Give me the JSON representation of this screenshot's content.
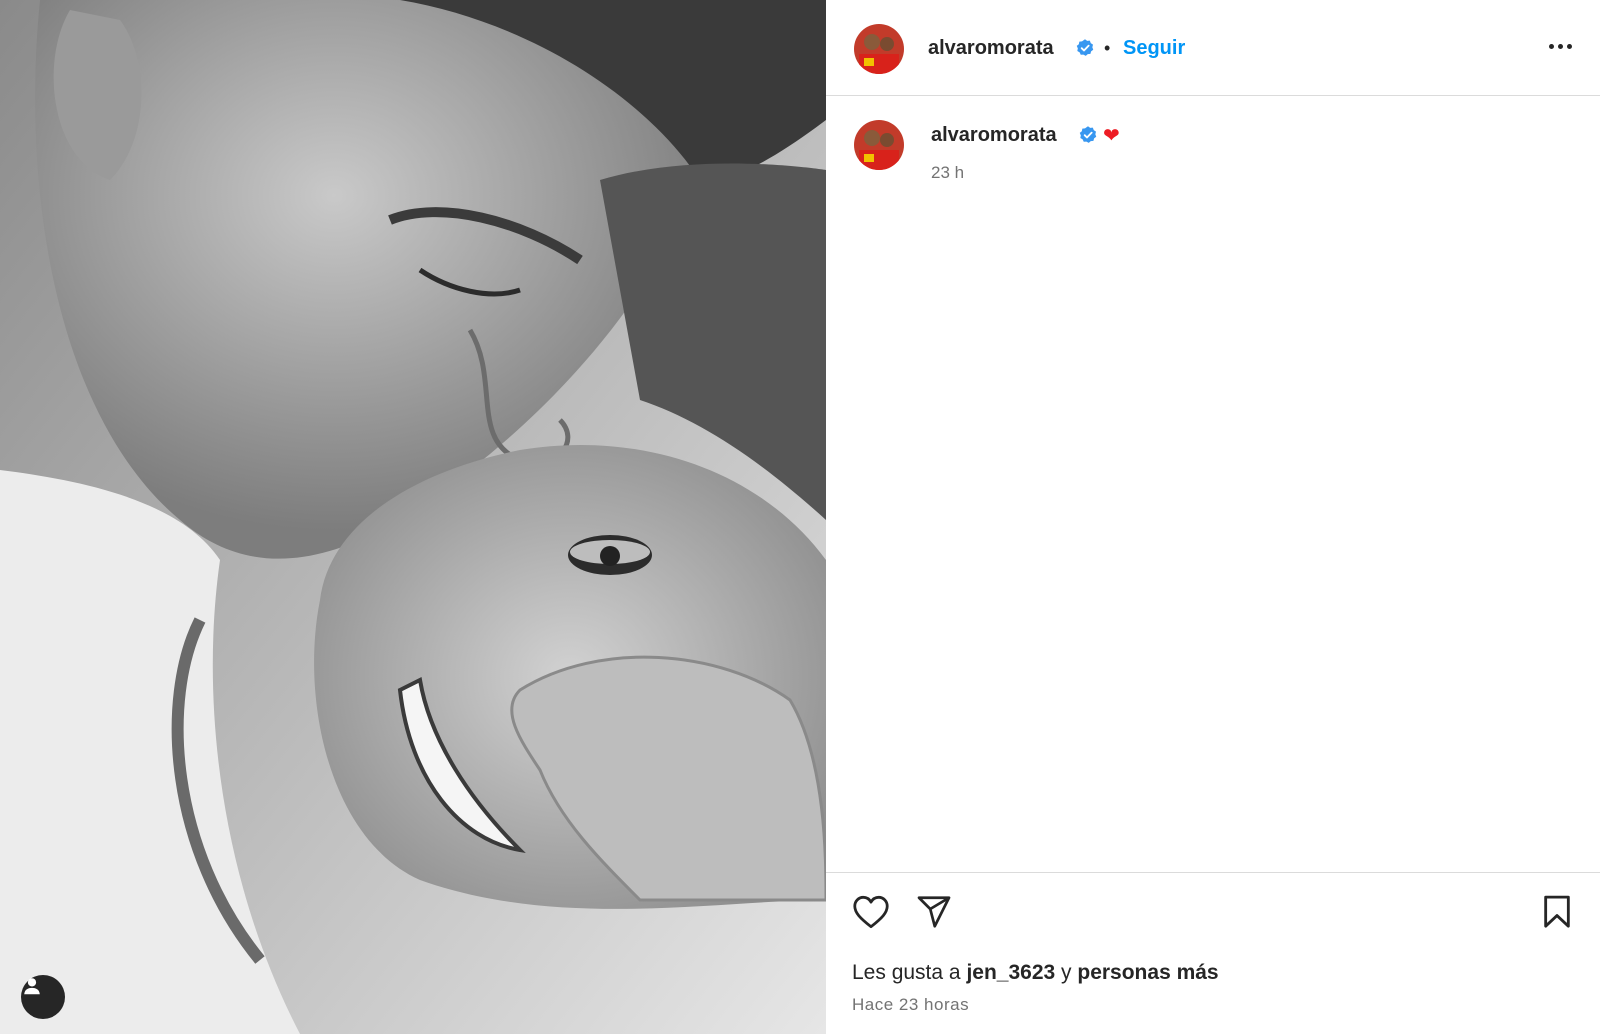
{
  "post": {
    "username": "alvaromorata",
    "follow_label": "Seguir",
    "separator": "•",
    "caption_emoji": "❤",
    "caption_time": "23 h",
    "likes_prefix": "Les gusta a",
    "likes_user": "jen_3623",
    "likes_joiner": "y",
    "likes_suffix": "personas más",
    "posted_ago": "Hace 23 horas"
  },
  "colors": {
    "link_blue": "#0095f6",
    "verified_blue": "#3897f0",
    "heart_red": "#ed1c24",
    "border": "#dbdbdb",
    "muted": "#737373"
  },
  "icons": {
    "more": "more-options-icon",
    "verified": "verified-badge-icon",
    "like": "heart-icon",
    "share": "paper-plane-icon",
    "save": "bookmark-icon",
    "tag": "user-tag-icon"
  }
}
